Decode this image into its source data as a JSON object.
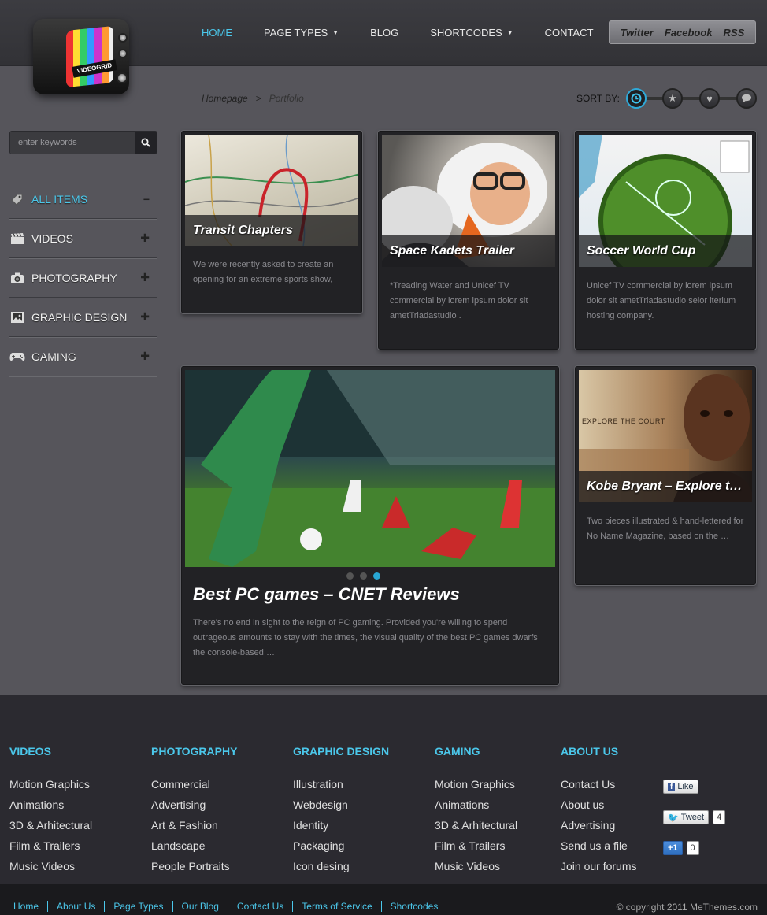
{
  "brand": {
    "logo_text": "VIDEOGRID"
  },
  "nav": {
    "items": [
      {
        "label": "HOME",
        "active": true,
        "dropdown": false
      },
      {
        "label": "PAGE TYPES",
        "active": false,
        "dropdown": true
      },
      {
        "label": "BLOG",
        "active": false,
        "dropdown": false
      },
      {
        "label": "SHORTCODES",
        "active": false,
        "dropdown": true
      },
      {
        "label": "CONTACT",
        "active": false,
        "dropdown": false
      }
    ]
  },
  "social": {
    "twitter": "Twitter",
    "facebook": "Facebook",
    "rss": "RSS"
  },
  "breadcrumb": {
    "home": "Homepage",
    "sep": ">",
    "current": "Portfolio"
  },
  "sort": {
    "label": "SORT BY:",
    "options": [
      "clock-icon",
      "star-icon",
      "heart-icon",
      "comment-icon"
    ],
    "active": "clock-icon"
  },
  "search": {
    "placeholder": "enter keywords"
  },
  "sidebar": {
    "categories": [
      {
        "label": "ALL ITEMS",
        "icon": "tag-icon",
        "toggle": "−",
        "active": true
      },
      {
        "label": "VIDEOS",
        "icon": "clapperboard-icon",
        "toggle": "✚",
        "active": false
      },
      {
        "label": "PHOTOGRAPHY",
        "icon": "camera-icon",
        "toggle": "✚",
        "active": false
      },
      {
        "label": "GRAPHIC DESIGN",
        "icon": "picture-icon",
        "toggle": "✚",
        "active": false
      },
      {
        "label": "GAMING",
        "icon": "gamepad-icon",
        "toggle": "✚",
        "active": false
      }
    ]
  },
  "cards": [
    {
      "title": "Transit Chapters",
      "desc": "We were recently asked to create an opening for an extreme sports show,"
    },
    {
      "title": "Space Kadets Trailer",
      "desc": "*Treading Water and Unicef TV commercial by lorem ipsum dolor sit ametTriadastudio ."
    },
    {
      "title": "Soccer World Cup",
      "desc": "Unicef TV commercial by lorem ipsum dolor sit ametTriadastudio selor iterium hosting company."
    },
    {
      "title": "Best PC games – CNET Reviews",
      "desc": "There's no end in sight to the reign of PC gaming. Provided you're willing to spend outrageous amounts to stay with the times, the visual quality of the best PC games dwarfs the console-based …"
    },
    {
      "title": "Kobe Bryant – Explore the court",
      "desc": "Two pieces illustrated & hand-lettered for No Name Magazine, based on the …",
      "image_caption": "EXPLORE THE COURT"
    }
  ],
  "slider": {
    "dots": 3,
    "active": 3
  },
  "footer": {
    "columns": [
      {
        "title": "VIDEOS",
        "items": [
          "Motion Graphics",
          "Animations",
          "3D & Arhitectural",
          "Film & Trailers",
          "Music Videos"
        ]
      },
      {
        "title": "PHOTOGRAPHY",
        "items": [
          "Commercial",
          "Advertising",
          "Art & Fashion",
          "Landscape",
          "People Portraits"
        ]
      },
      {
        "title": "GRAPHIC DESIGN",
        "items": [
          "Illustration",
          "Webdesign",
          "Identity",
          "Packaging",
          "Icon desing"
        ]
      },
      {
        "title": "GAMING",
        "items": [
          "Motion Graphics",
          "Animations",
          "3D & Arhitectural",
          "Film & Trailers",
          "Music Videos"
        ]
      },
      {
        "title": "ABOUT US",
        "items": [
          "Contact Us",
          "About us",
          "Advertising",
          "Send us a file",
          "Join our forums"
        ]
      }
    ],
    "social": {
      "like": "Like",
      "tweet": "Tweet",
      "tweet_count": "4",
      "plusone": "+1",
      "plusone_count": "0"
    },
    "bottom_links": [
      "Home",
      "About Us",
      "Page Types",
      "Our Blog",
      "Contact Us",
      "Terms of Service",
      "Shortcodes"
    ],
    "copyright": "© copyright 2011 MeThemes.com"
  },
  "colors": {
    "accent": "#4bc7ea",
    "page_bg": "#56555b",
    "card_bg": "#222225",
    "footer_bg": "#2b2a30"
  }
}
